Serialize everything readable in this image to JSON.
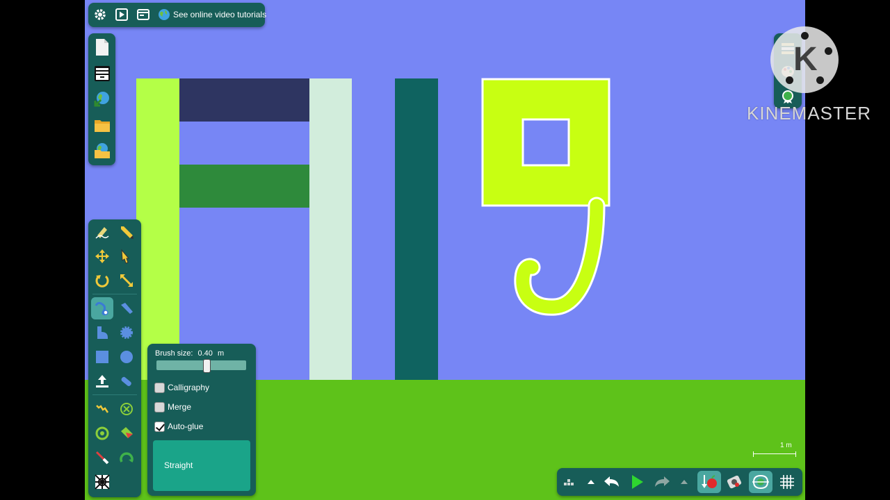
{
  "top_bar": {
    "icons": [
      "gear-icon",
      "play-video-icon",
      "window-icon",
      "globe-icon"
    ],
    "tutorials_label": "See online video tutorials"
  },
  "file_panel": {
    "icons": [
      "new-file-icon",
      "archive-box-icon",
      "globe-export-icon",
      "folder-icon",
      "save-icon"
    ]
  },
  "tools_panel": {
    "active_tool": "spline-draw-icon",
    "icons": [
      "sketch-icon",
      "pencil-icon",
      "move-icon",
      "drag-hand-icon",
      "rotate-icon",
      "scale-icon",
      "spline-draw-icon",
      "knife-icon",
      "polygon-icon",
      "gear-wheel-icon",
      "box-icon",
      "circle-icon",
      "thruster-icon",
      "tracer-icon",
      "spring-icon",
      "fixate-icon",
      "axle-icon",
      "paint-icon",
      "laser-icon",
      "hinge-icon",
      "hypno-icon"
    ]
  },
  "brush_panel": {
    "brush_size_label": "Brush size:",
    "brush_size_value": "0.40",
    "brush_size_unit": "m",
    "brush_fraction": 0.56,
    "options": [
      {
        "label": "Calligraphy",
        "checked": false
      },
      {
        "label": "Merge",
        "checked": false
      },
      {
        "label": "Auto-glue",
        "checked": true
      }
    ],
    "straight_label": "Straight"
  },
  "bottom_bar": {
    "icons": [
      "layers-icon",
      "up-arrow-icon",
      "undo-icon",
      "play-icon",
      "redo-icon",
      "up-arrow-icon-2",
      "gravity-icon",
      "camera-icon",
      "snap-icon",
      "grid-icon"
    ]
  },
  "right_panel": {
    "icons": [
      "list-icon",
      "palette-icon",
      "badge-icon"
    ]
  },
  "scale": {
    "label": "1 m"
  },
  "watermark": {
    "text": "KINEMASTER"
  },
  "colors": {
    "sky": "#7786f5",
    "ground": "#5ec21a",
    "panel": "#175d58",
    "lime": "#b4ff47",
    "yellow_lime": "#c8ff12",
    "navy": "#2e3561",
    "forest": "#2e8a3b",
    "mint": "#d2eddc",
    "teal": "#0f6360"
  }
}
